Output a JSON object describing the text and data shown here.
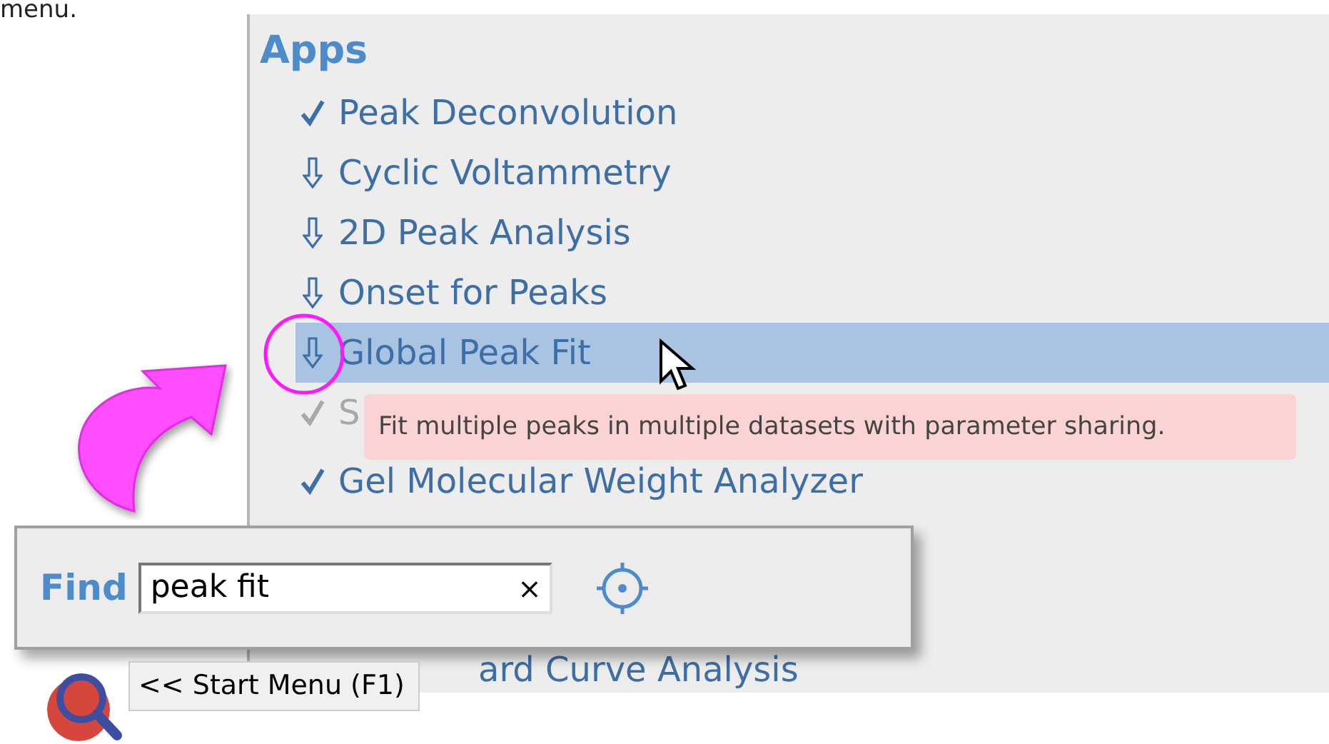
{
  "page_text": "menu.",
  "panel": {
    "title": "Apps",
    "items": [
      {
        "label": "Peak Deconvolution",
        "kind": "installed",
        "selected": false,
        "disabled": false
      },
      {
        "label": "Cyclic Voltammetry",
        "kind": "available",
        "selected": false,
        "disabled": false
      },
      {
        "label": "2D Peak Analysis",
        "kind": "available",
        "selected": false,
        "disabled": false
      },
      {
        "label": "Onset for Peaks",
        "kind": "available",
        "selected": false,
        "disabled": false
      },
      {
        "label": "Global Peak Fit",
        "kind": "available",
        "selected": true,
        "disabled": false
      },
      {
        "label": "S",
        "kind": "installed",
        "selected": false,
        "disabled": true
      },
      {
        "label": "Gel Molecular Weight Analyzer",
        "kind": "installed",
        "selected": false,
        "disabled": false
      },
      {
        "label": "ard Curve Analysis",
        "kind": "partial",
        "selected": false,
        "disabled": false
      }
    ]
  },
  "tooltip": {
    "text": "Fit multiple peaks in multiple datasets with parameter sharing."
  },
  "find": {
    "label": "Find",
    "value": "peak fit",
    "clear": "×"
  },
  "start_menu": {
    "label": "<< Start Menu (F1)"
  }
}
